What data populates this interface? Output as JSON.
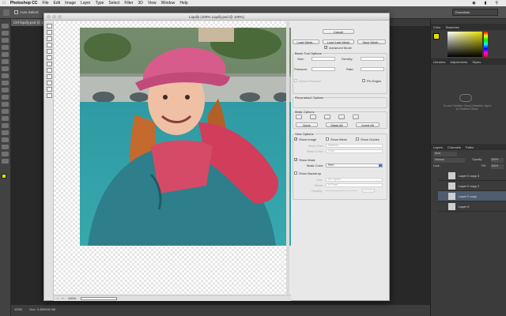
{
  "menubar": {
    "app_name": "Photoshop CC",
    "items": [
      "File",
      "Edit",
      "Image",
      "Layer",
      "Type",
      "Select",
      "Filter",
      "3D",
      "View",
      "Window",
      "Help"
    ],
    "right_items": [
      "Essentials"
    ]
  },
  "options_bar": {
    "auto_select_label": "Auto-Select:"
  },
  "document": {
    "tab_title": "Ctrl-liquify.psd @ 100%",
    "status_zoom": "100%",
    "status_doc": "Doc: 3.49M/18.9M"
  },
  "right_panel": {
    "color_tabs": [
      "Color",
      "Swatches"
    ],
    "library_tabs": [
      "Libraries",
      "Adjustments",
      "Styles"
    ],
    "library_message": "To use Creative Cloud Libraries, log in to Creative Cloud.",
    "layers_tabs": [
      "Layers",
      "Channels",
      "Paths"
    ],
    "kind_label": "Kind",
    "blend_mode": "Normal",
    "opacity_label": "Opacity:",
    "opacity_value": "100%",
    "lock_label": "Lock:",
    "fill_label": "Fill:",
    "fill_value": "100%",
    "layers": [
      {
        "name": "Layer 0 copy 3",
        "selected": false
      },
      {
        "name": "Layer 0 copy 2",
        "selected": false
      },
      {
        "name": "Layer 0 copy",
        "selected": true
      },
      {
        "name": "Layer 0",
        "selected": false
      }
    ]
  },
  "liquify": {
    "title": "Liquify (100% Liquify.psd @ 100%)",
    "zoom_value": "100%",
    "cancel_label": "Cancel",
    "load_mesh_label": "Load Mesh...",
    "load_last_mesh_label": "Load Last Mesh",
    "save_mesh_label": "Save Mesh...",
    "advanced_mode_label": "Advanced Mode",
    "advanced_mode_checked": true,
    "brush_tool_options": {
      "legend": "Brush Tool Options",
      "size_label": "Size:",
      "density_label": "Density:",
      "pressure_label": "Pressure:",
      "rate_label": "Rate:",
      "stylus_pressure_label": "Stylus Pressure",
      "pin_edges_label": "Pin Edges"
    },
    "reconstruct_options": {
      "legend": "Reconstruct Options"
    },
    "mask_options": {
      "legend": "Mask Options",
      "none_label": "None",
      "mask_all_label": "Mask All",
      "invert_all_label": "Invert All"
    },
    "view_options": {
      "legend": "View Options",
      "show_image_label": "Show Image",
      "show_image_checked": true,
      "show_mesh_label": "Show Mesh",
      "show_guides_label": "Show Guides",
      "mesh_size_label": "Mesh Size:",
      "mesh_size_value": "Medium",
      "mesh_color_label": "Mesh Color:",
      "mesh_color_value": "Gray",
      "show_mask_label": "Show Mask",
      "show_mask_checked": true,
      "mask_color_label": "Mask Color:",
      "mask_color_value": "Red",
      "show_backdrop_label": "Show Backdrop",
      "use_label": "Use:",
      "use_value": "All Layers",
      "mode_label": "Mode:",
      "mode_value": "In Front",
      "opacity_label": "Opacity:"
    }
  },
  "colors": {
    "accent_blue": "#3a78d8",
    "dialog_bg": "#e8e8e8",
    "ps_dark": "#3b3b3b"
  }
}
